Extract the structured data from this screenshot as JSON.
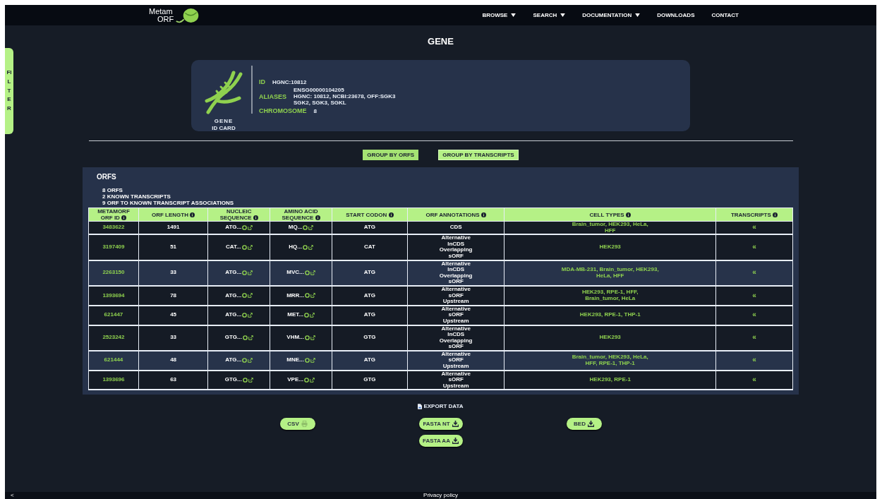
{
  "nav": {
    "logo_line1": "Metam",
    "logo_line2": "ORF",
    "items": [
      {
        "label": "BROWSE",
        "dropdown": true
      },
      {
        "label": "SEARCH",
        "dropdown": true
      },
      {
        "label": "DOCUMENTATION",
        "dropdown": true
      },
      {
        "label": "DOWNLOADS",
        "dropdown": false
      },
      {
        "label": "CONTACT",
        "dropdown": false
      }
    ]
  },
  "filter_tab": "FILTER",
  "title": "GENE",
  "id_card": {
    "caption": "GENE",
    "subcaption": "ID CARD",
    "fields": [
      {
        "label": "ID",
        "lines": [
          "HGNC:10812"
        ]
      },
      {
        "label": "ALIASES",
        "lines": [
          "ENSG00000104205",
          "HGNC: 10812, NCBI:23678, OFF:SGK3",
          "SGK2, SGK3, SGKL"
        ]
      },
      {
        "label": "CHROMOSOME",
        "lines": [
          "8"
        ]
      }
    ]
  },
  "group_buttons": [
    {
      "label": "GROUP BY ORFS",
      "selected": true
    },
    {
      "label": "GROUP BY TRANSCRIPTS",
      "selected": false
    }
  ],
  "orfs": {
    "title": "ORFS",
    "summary": [
      "8 ORFS",
      "2 KNOWN TRANSCRIPTS",
      "9 ORF TO KNOWN TRANSCRIPT ASSOCIATIONS"
    ],
    "columns": [
      {
        "label": "METAMORF ORF ID"
      },
      {
        "label": "ORF LENGTH"
      },
      {
        "label": "NUCLEIC SEQUENCE"
      },
      {
        "label": "AMINO ACID SEQUENCE"
      },
      {
        "label": "START CODON"
      },
      {
        "label": "ORF ANNOTATIONS"
      },
      {
        "label": "CELL TYPES"
      },
      {
        "label": "TRANSCRIPTS"
      }
    ],
    "rows": [
      {
        "id": "3483622",
        "length": "1491",
        "nucleic": "ATG...",
        "amino": "MQ...",
        "codon": "ATG",
        "annotations": [
          "CDS"
        ],
        "cell_types": [
          "Brain_tumor, HEK293, HeLa,",
          "HFF"
        ],
        "transcripts": "«",
        "highlighted": false
      },
      {
        "id": "3197409",
        "length": "51",
        "nucleic": "CAT...",
        "amino": "HQ...",
        "codon": "CAT",
        "annotations": [
          "Alternative",
          "InCDS",
          "Overlapping",
          "sORF"
        ],
        "cell_types": [
          "HEK293"
        ],
        "transcripts": "«",
        "highlighted": false
      },
      {
        "id": "2263150",
        "length": "33",
        "nucleic": "ATG...",
        "amino": "MVC...",
        "codon": "ATG",
        "annotations": [
          "Alternative",
          "InCDS",
          "Overlapping",
          "sORF"
        ],
        "cell_types": [
          "MDA-MB-231, Brain_tumor, HEK293,",
          "HeLa, HFF"
        ],
        "transcripts": "«",
        "highlighted": true
      },
      {
        "id": "1393694",
        "length": "78",
        "nucleic": "ATG...",
        "amino": "MRR...",
        "codon": "ATG",
        "annotations": [
          "Alternative",
          "sORF",
          "Upstream"
        ],
        "cell_types": [
          "HEK293, RPE-1, HFF,",
          "Brain_tumor, HeLa"
        ],
        "transcripts": "«",
        "highlighted": false
      },
      {
        "id": "621447",
        "length": "45",
        "nucleic": "ATG...",
        "amino": "MET...",
        "codon": "ATG",
        "annotations": [
          "Alternative",
          "sORF",
          "Upstream"
        ],
        "cell_types": [
          "HEK293, RPE-1, THP-1"
        ],
        "transcripts": "«",
        "highlighted": false
      },
      {
        "id": "2523242",
        "length": "33",
        "nucleic": "GTG...",
        "amino": "VHM...",
        "codon": "GTG",
        "annotations": [
          "Alternative",
          "InCDS",
          "Overlapping",
          "sORF"
        ],
        "cell_types": [
          "HEK293"
        ],
        "transcripts": "«",
        "highlighted": false
      },
      {
        "id": "621444",
        "length": "48",
        "nucleic": "ATG...",
        "amino": "MNE...",
        "codon": "ATG",
        "annotations": [
          "Alternative",
          "sORF",
          "Upstream"
        ],
        "cell_types": [
          "Brain_tumor, HEK293, HeLa,",
          "HFF, RPE-1, THP-1"
        ],
        "transcripts": "«",
        "highlighted": true
      },
      {
        "id": "1393696",
        "length": "63",
        "nucleic": "GTG...",
        "amino": "VPE...",
        "codon": "GTG",
        "annotations": [
          "Alternative",
          "sORF",
          "Upstream"
        ],
        "cell_types": [
          "HEK293, RPE-1"
        ],
        "transcripts": "«",
        "highlighted": false
      }
    ]
  },
  "export": {
    "label": "EXPORT DATA",
    "buttons": [
      {
        "label": "CSV",
        "kind": "print"
      },
      {
        "label": "FASTA NT",
        "kind": "download"
      },
      {
        "label": "BED",
        "kind": "download"
      },
      {
        "label": "FASTA AA",
        "kind": "download"
      }
    ]
  },
  "footer": {
    "back": "<",
    "link": "Privacy policy"
  }
}
